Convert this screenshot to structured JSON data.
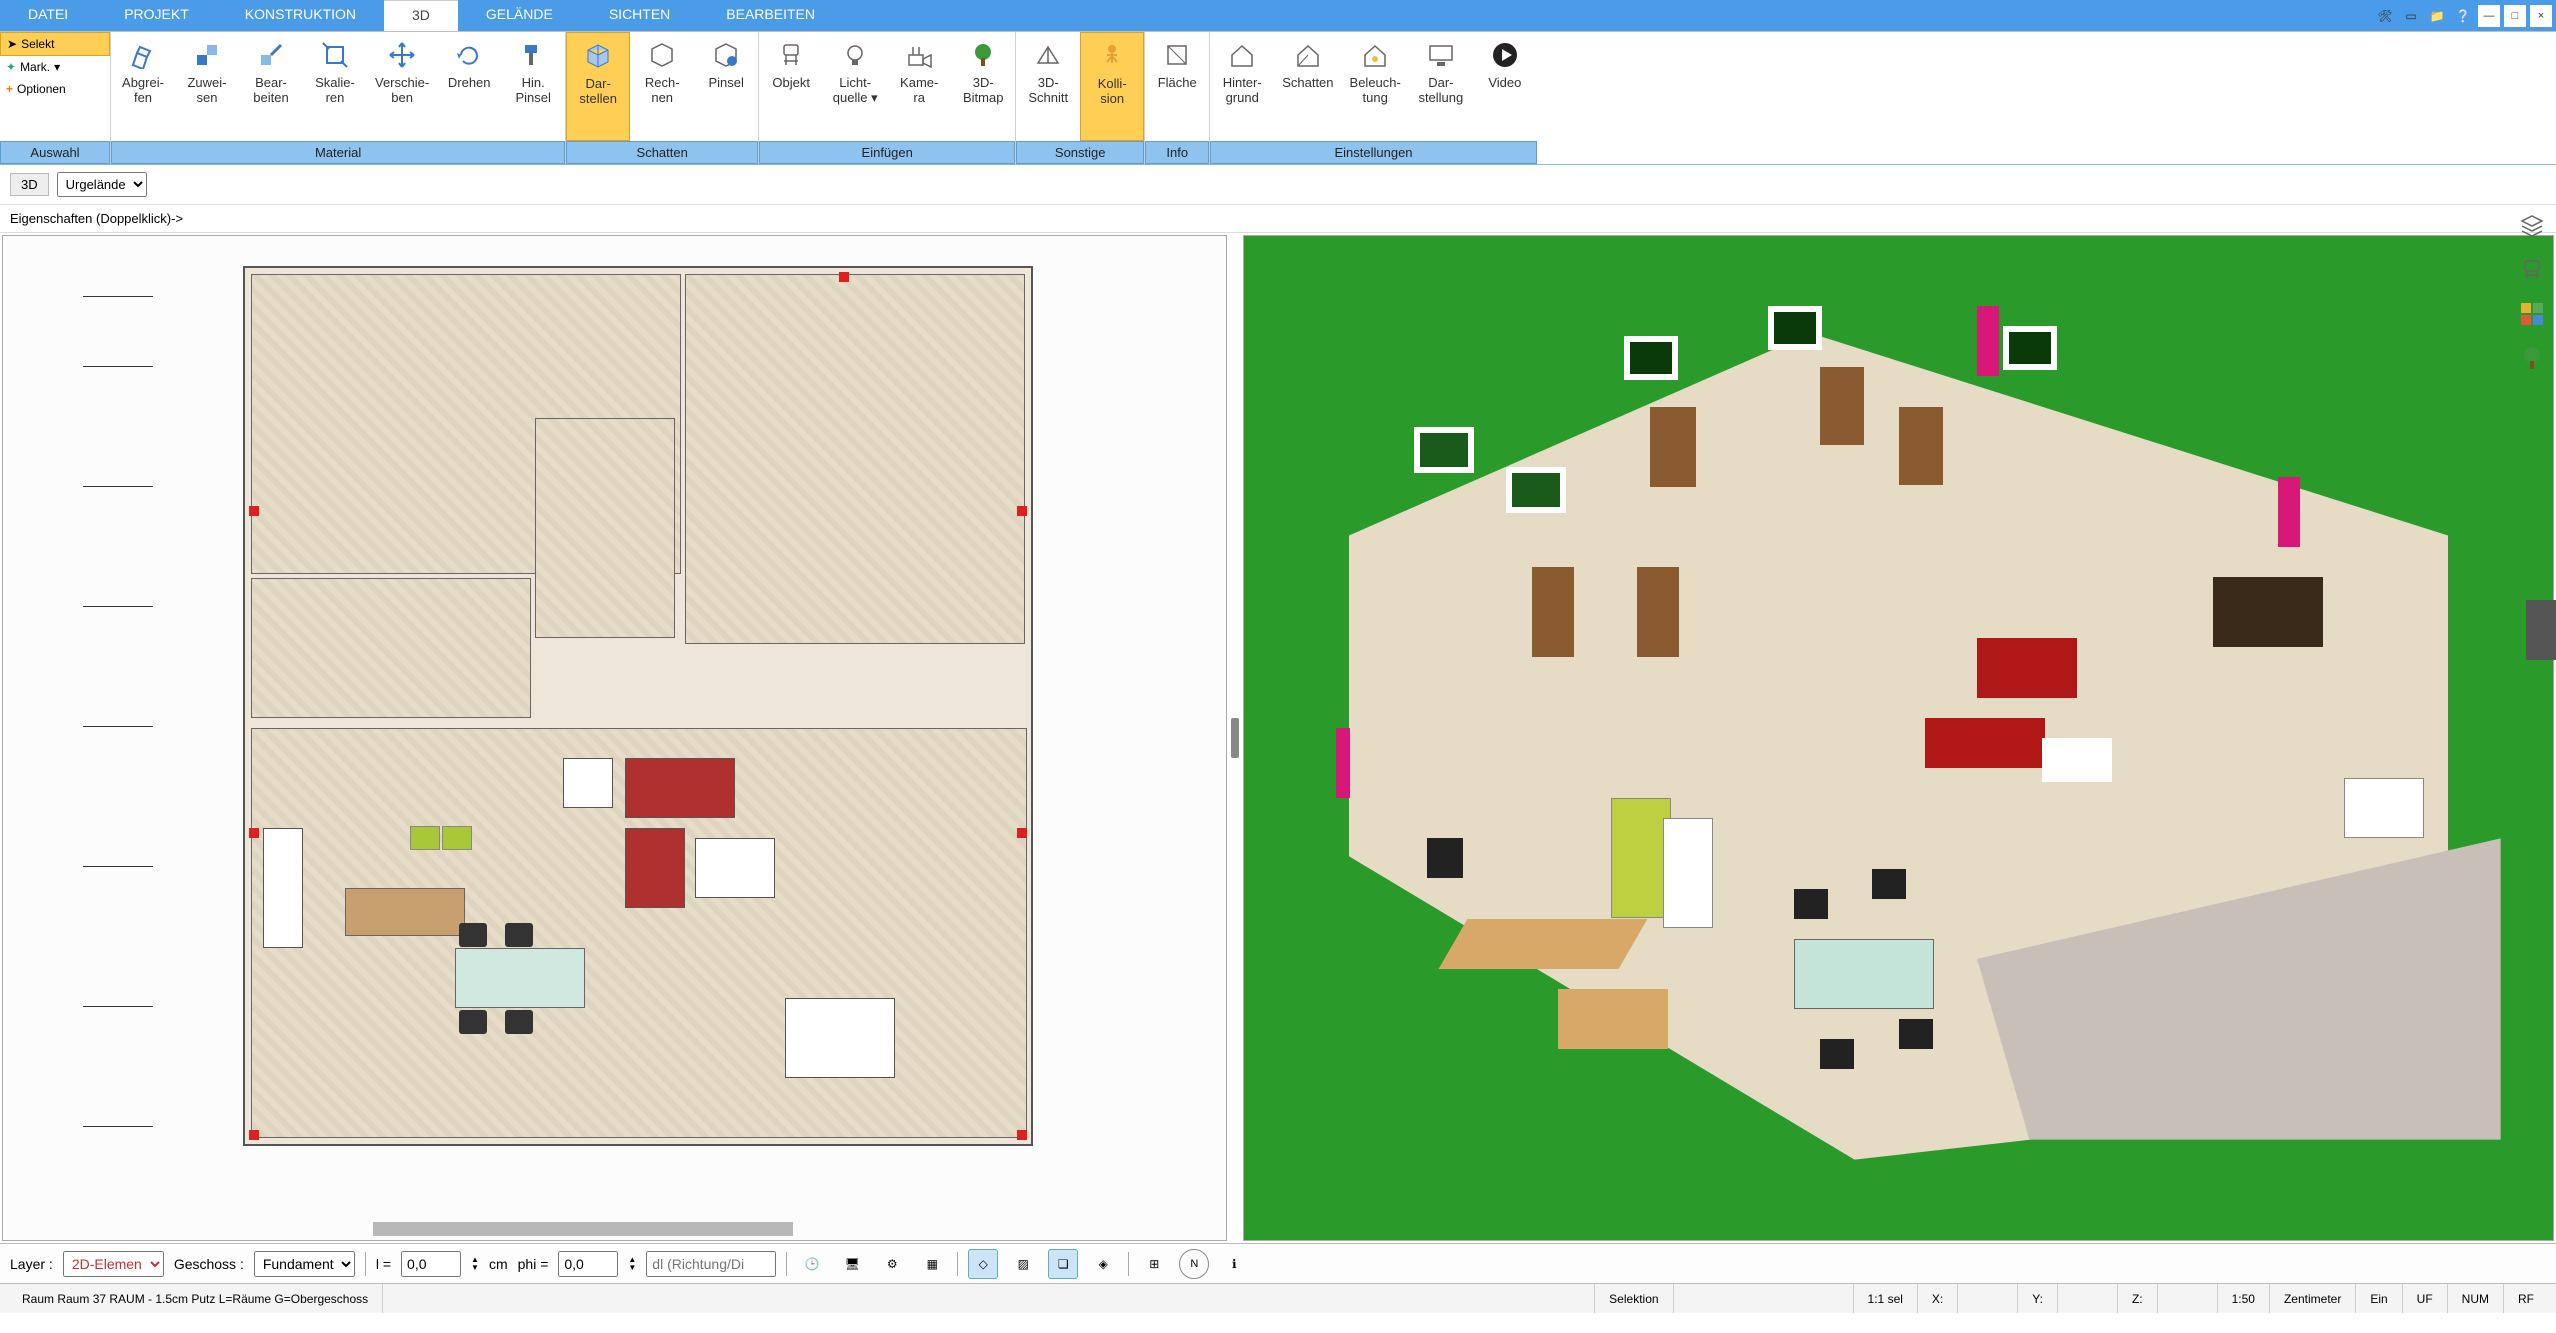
{
  "menubar": {
    "tabs": [
      "DATEI",
      "PROJEKT",
      "KONSTRUKTION",
      "3D",
      "GELÄNDE",
      "SICHTEN",
      "BEARBEITEN"
    ],
    "active_index": 3
  },
  "ribbon_left": {
    "select": "Selekt",
    "mark": "Mark.",
    "optionen": "Optionen",
    "auswahl": "Auswahl"
  },
  "ribbon_groups": [
    {
      "label": "Material",
      "items": [
        {
          "l1": "Abgrei-",
          "l2": "fen",
          "icon": "pencil"
        },
        {
          "l1": "Zuwei-",
          "l2": "sen",
          "icon": "assign"
        },
        {
          "l1": "Bear-",
          "l2": "beiten",
          "icon": "edit"
        },
        {
          "l1": "Skalie-",
          "l2": "ren",
          "icon": "scale"
        },
        {
          "l1": "Verschie-",
          "l2": "ben",
          "icon": "move"
        },
        {
          "l1": "Drehen",
          "l2": "",
          "icon": "rotate"
        },
        {
          "l1": "Hin.",
          "l2": "Pinsel",
          "icon": "brush"
        }
      ]
    },
    {
      "label": "Schatten",
      "items": [
        {
          "l1": "Dar-",
          "l2": "stellen",
          "icon": "cube",
          "active": true
        },
        {
          "l1": "Rech-",
          "l2": "nen",
          "icon": "cube2"
        },
        {
          "l1": "Pinsel",
          "l2": "",
          "icon": "cube-brush"
        }
      ]
    },
    {
      "label": "Einfügen",
      "items": [
        {
          "l1": "Objekt",
          "l2": "",
          "icon": "chair"
        },
        {
          "l1": "Licht-",
          "l2": "quelle",
          "icon": "bulb",
          "dd": true
        },
        {
          "l1": "Kame-",
          "l2": "ra",
          "icon": "camera"
        },
        {
          "l1": "3D-",
          "l2": "Bitmap",
          "icon": "tree"
        }
      ]
    },
    {
      "label": "Sonstige",
      "items": [
        {
          "l1": "3D-",
          "l2": "Schnitt",
          "icon": "section"
        },
        {
          "l1": "Kolli-",
          "l2": "sion",
          "icon": "person",
          "active": true
        }
      ]
    },
    {
      "label": "Info",
      "items": [
        {
          "l1": "Fläche",
          "l2": "",
          "icon": "area"
        }
      ]
    },
    {
      "label": "Einstellungen",
      "items": [
        {
          "l1": "Hinter-",
          "l2": "grund",
          "icon": "house"
        },
        {
          "l1": "Schatten",
          "l2": "",
          "icon": "house2"
        },
        {
          "l1": "Beleuch-",
          "l2": "tung",
          "icon": "house3"
        },
        {
          "l1": "Dar-",
          "l2": "stellung",
          "icon": "monitor"
        },
        {
          "l1": "Video",
          "l2": "",
          "icon": "play"
        }
      ]
    }
  ],
  "subbar": {
    "mode": "3D",
    "terrain_options": [
      "Urgelände"
    ],
    "hint": "Eigenschaften (Doppelklick)->"
  },
  "bottombar": {
    "layer_label": "Layer :",
    "layer_value": "2D-Elemen",
    "geschoss_label": "Geschoss :",
    "geschoss_value": "Fundament",
    "l_label": "l =",
    "l_value": "0,0",
    "unit": "cm",
    "phi_label": "phi =",
    "phi_value": "0,0",
    "dl_placeholder": "dl (Richtung/Di"
  },
  "statusbar": {
    "left": "Raum Raum 37 RAUM - 1.5cm Putz L=Räume G=Obergeschoss",
    "selektion": "Selektion",
    "ratio": "1:1 sel",
    "x": "X:",
    "y": "Y:",
    "z": "Z:",
    "scale": "1:50",
    "unit": "Zentimeter",
    "ein": "Ein",
    "uf": "UF",
    "num": "NUM",
    "rf": "RF"
  }
}
